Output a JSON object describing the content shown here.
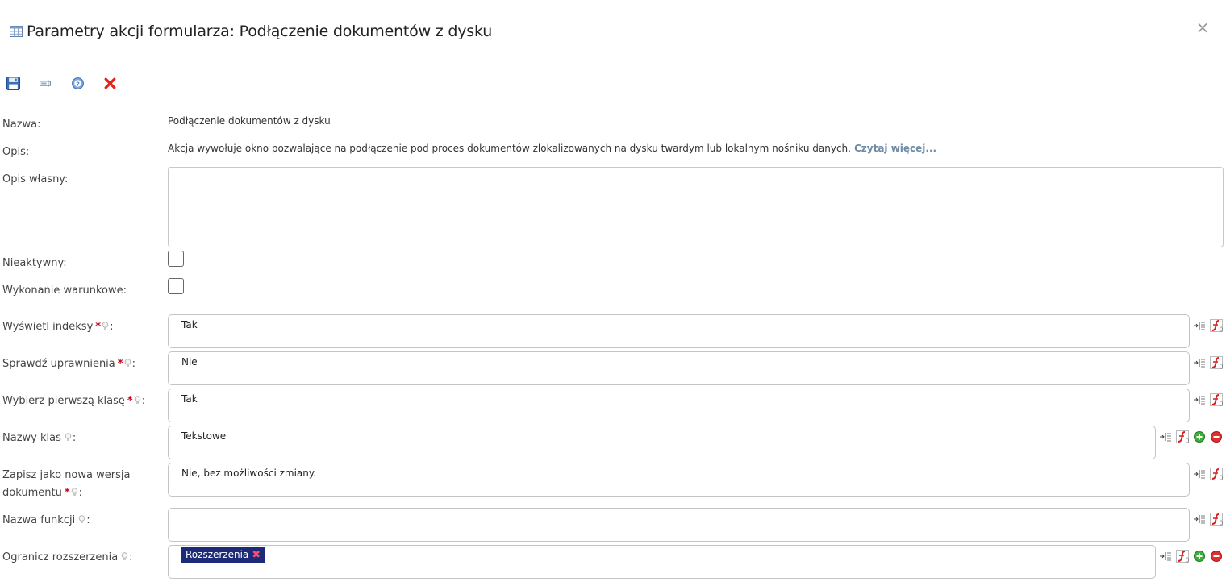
{
  "dialog": {
    "title": "Parametry akcji formularza: Podłączenie dokumentów z dysku",
    "close_glyph": "×"
  },
  "toolbar": {
    "items": [
      {
        "name": "save-icon"
      },
      {
        "name": "rename-icon"
      },
      {
        "name": "help-icon"
      },
      {
        "name": "delete-icon"
      }
    ]
  },
  "form": {
    "nazwa_label": "Nazwa:",
    "nazwa_value": "Podłączenie dokumentów z dysku",
    "opis_label": "Opis:",
    "opis_value": "Akcja wywołuje okno pozwalające na podłączenie pod proces dokumentów zlokalizowanych na dysku twardym lub lokalnym nośniku danych.",
    "opis_more": "Czytaj więcej...",
    "opis_wlasny_label": "Opis własny:",
    "opis_wlasny_value": "",
    "nieaktywny_label": "Nieaktywny:",
    "nieaktywny_checked": false,
    "wykonanie_label": "Wykonanie warunkowe:",
    "wykonanie_checked": false
  },
  "params": [
    {
      "label": "Wyświetl indeksy",
      "required": true,
      "value": "Tak",
      "actions": [
        "map-icon",
        "formula-icon"
      ]
    },
    {
      "label": "Sprawdź uprawnienia",
      "required": true,
      "value": "Nie",
      "actions": [
        "map-icon",
        "formula-icon"
      ]
    },
    {
      "label": "Wybierz pierwszą klasę",
      "required": true,
      "value": "Tak",
      "actions": [
        "map-icon",
        "formula-icon"
      ]
    },
    {
      "label": "Nazwy klas",
      "required": false,
      "value": "Tekstowe",
      "actions": [
        "map-icon",
        "formula-icon",
        "add-icon",
        "remove-icon"
      ]
    },
    {
      "label_line1": "Zapisz jako nowa wersja",
      "label_line2": "dokumentu",
      "required": true,
      "value": "Nie, bez możliwości zmiany.",
      "actions": [
        "map-icon",
        "formula-icon"
      ]
    },
    {
      "label": "Nazwa funkcji",
      "required": false,
      "value": "",
      "actions": [
        "map-icon",
        "formula-icon"
      ]
    },
    {
      "label": "Ogranicz rozszerzenia",
      "required": false,
      "tag": "Rozszerzenia",
      "tag_remove": "✖",
      "actions": [
        "map-icon",
        "formula-icon",
        "add-icon",
        "remove-icon"
      ]
    }
  ],
  "common": {
    "required_mark": "*",
    "colon": ":"
  },
  "colors": {
    "divider": "#7a93ac",
    "tag_bg": "#1d2a78",
    "link": "#6d8ba6",
    "required": "#d0021b"
  }
}
